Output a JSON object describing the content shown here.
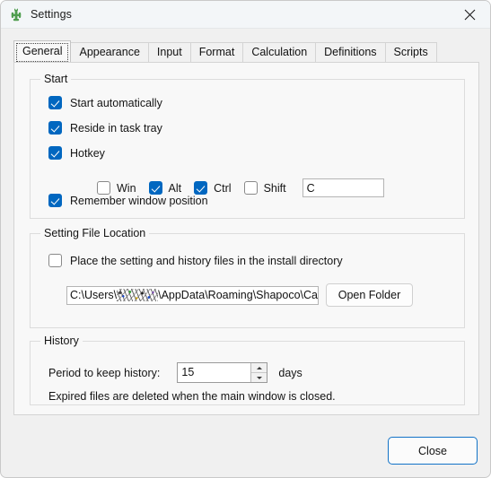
{
  "window": {
    "title": "Settings",
    "app_icon": "cactus-icon",
    "close_icon": "close-icon"
  },
  "tabs": [
    {
      "label": "General",
      "selected": true
    },
    {
      "label": "Appearance",
      "selected": false
    },
    {
      "label": "Input",
      "selected": false
    },
    {
      "label": "Format",
      "selected": false
    },
    {
      "label": "Calculation",
      "selected": false
    },
    {
      "label": "Definitions",
      "selected": false
    },
    {
      "label": "Scripts",
      "selected": false
    }
  ],
  "groups": {
    "start": {
      "title": "Start",
      "options": [
        {
          "label": "Start automatically",
          "checked": true
        },
        {
          "label": "Reside in task tray",
          "checked": true
        },
        {
          "label": "Hotkey",
          "checked": true
        },
        {
          "label": "Remember window position",
          "checked": true
        }
      ],
      "hotkey": {
        "modifiers": [
          {
            "label": "Win",
            "checked": false
          },
          {
            "label": "Alt",
            "checked": true
          },
          {
            "label": "Ctrl",
            "checked": true
          },
          {
            "label": "Shift",
            "checked": false
          }
        ],
        "key_value": "C"
      }
    },
    "location": {
      "title": "Setting File Location",
      "install_dir_option": {
        "label": "Place the setting and history files in the install directory",
        "checked": false
      },
      "path_prefix": "C:\\Users\\",
      "path_suffix": "\\AppData\\Roaming\\Shapoco\\Calc",
      "path_redacted_note": "username-redacted",
      "open_folder_label": "Open Folder"
    },
    "history": {
      "title": "History",
      "period_label": "Period to keep history:",
      "period_value": "15",
      "unit_label": "days",
      "note": "Expired files are deleted when the main window is closed."
    }
  },
  "footer": {
    "close_label": "Close"
  },
  "colors": {
    "accent": "#0067c0",
    "default_button_border": "#1273c7",
    "window_bg": "#f0f0f0",
    "panel_bg": "#f8f8f8",
    "titlebar_bg": "#f3f6f8",
    "icon_green": "#4f9d4f"
  }
}
